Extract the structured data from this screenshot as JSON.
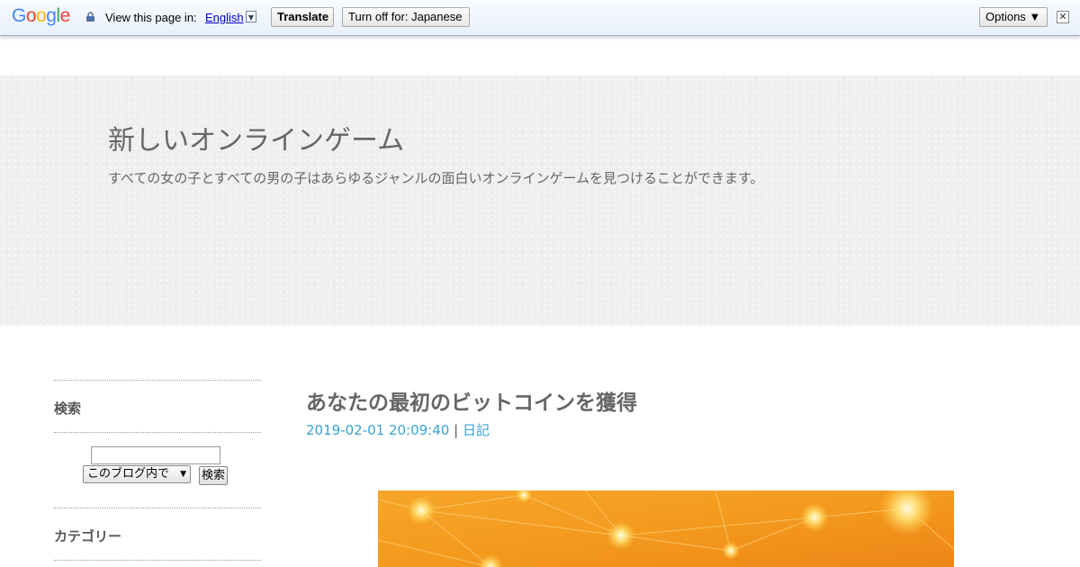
{
  "translate_bar": {
    "logo": "Google",
    "view_label": "View this page in:",
    "language": "English",
    "translate_btn": "Translate",
    "turn_off_btn": "Turn off for: Japanese",
    "options_btn": "Options ▼",
    "close": "✕"
  },
  "header": {
    "title": "新しいオンラインゲーム",
    "description": "すべての女の子とすべての男の子はあらゆるジャンルの面白いオンラインゲームを見つけることができます。"
  },
  "sidebar": {
    "search_heading": "検索",
    "search_input_value": "",
    "search_scope": "このブログ内で",
    "search_button": "検索",
    "category_heading": "カテゴリー"
  },
  "post": {
    "title": "あなたの最初のビットコインを獲得",
    "date": "2019-02-01 20:09:40",
    "separator": "|",
    "category": "日記"
  },
  "colors": {
    "link": "#3aa3d6",
    "header_bg": "#efefef",
    "image_orange": "#f39a1e"
  }
}
